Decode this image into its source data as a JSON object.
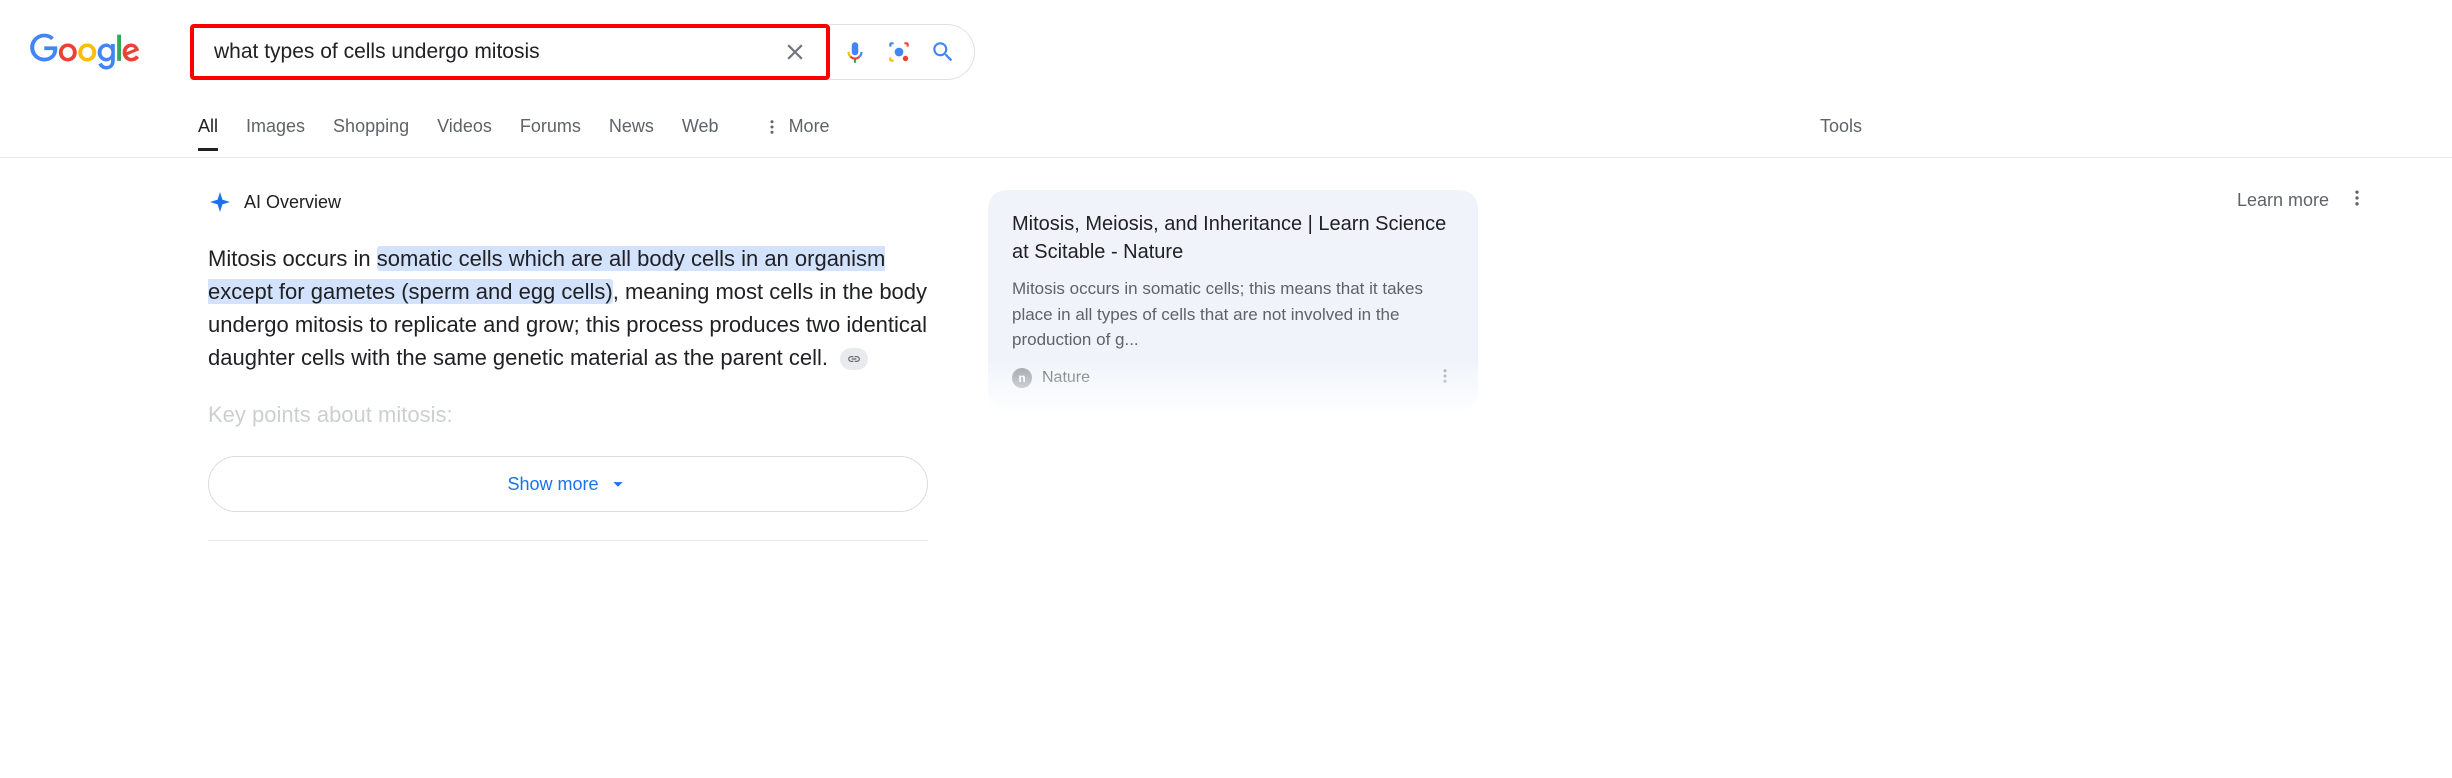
{
  "search": {
    "query": "what types of cells undergo mitosis"
  },
  "tabs": {
    "items": [
      "All",
      "Images",
      "Shopping",
      "Videos",
      "Forums",
      "News",
      "Web"
    ],
    "more": "More",
    "tools": "Tools"
  },
  "ai": {
    "title": "AI Overview",
    "learn_more": "Learn more",
    "text_prefix": "Mitosis occurs in ",
    "text_highlight": "somatic cells which are all body cells in an organism except for gametes (sperm and egg cells)",
    "text_suffix": ", meaning most cells in the body undergo mitosis to replicate and grow; this process produces two identical daughter cells with the same genetic material as the parent cell.",
    "key_points": "Key points about mitosis:",
    "show_more": "Show more"
  },
  "side_card": {
    "title": "Mitosis, Meiosis, and Inheritance | Learn Science at Scitable - Nature",
    "snippet": "Mitosis occurs in somatic cells; this means that it takes place in all types of cells that are not involved in the production of g...",
    "source": "Nature",
    "source_initial": "n"
  }
}
